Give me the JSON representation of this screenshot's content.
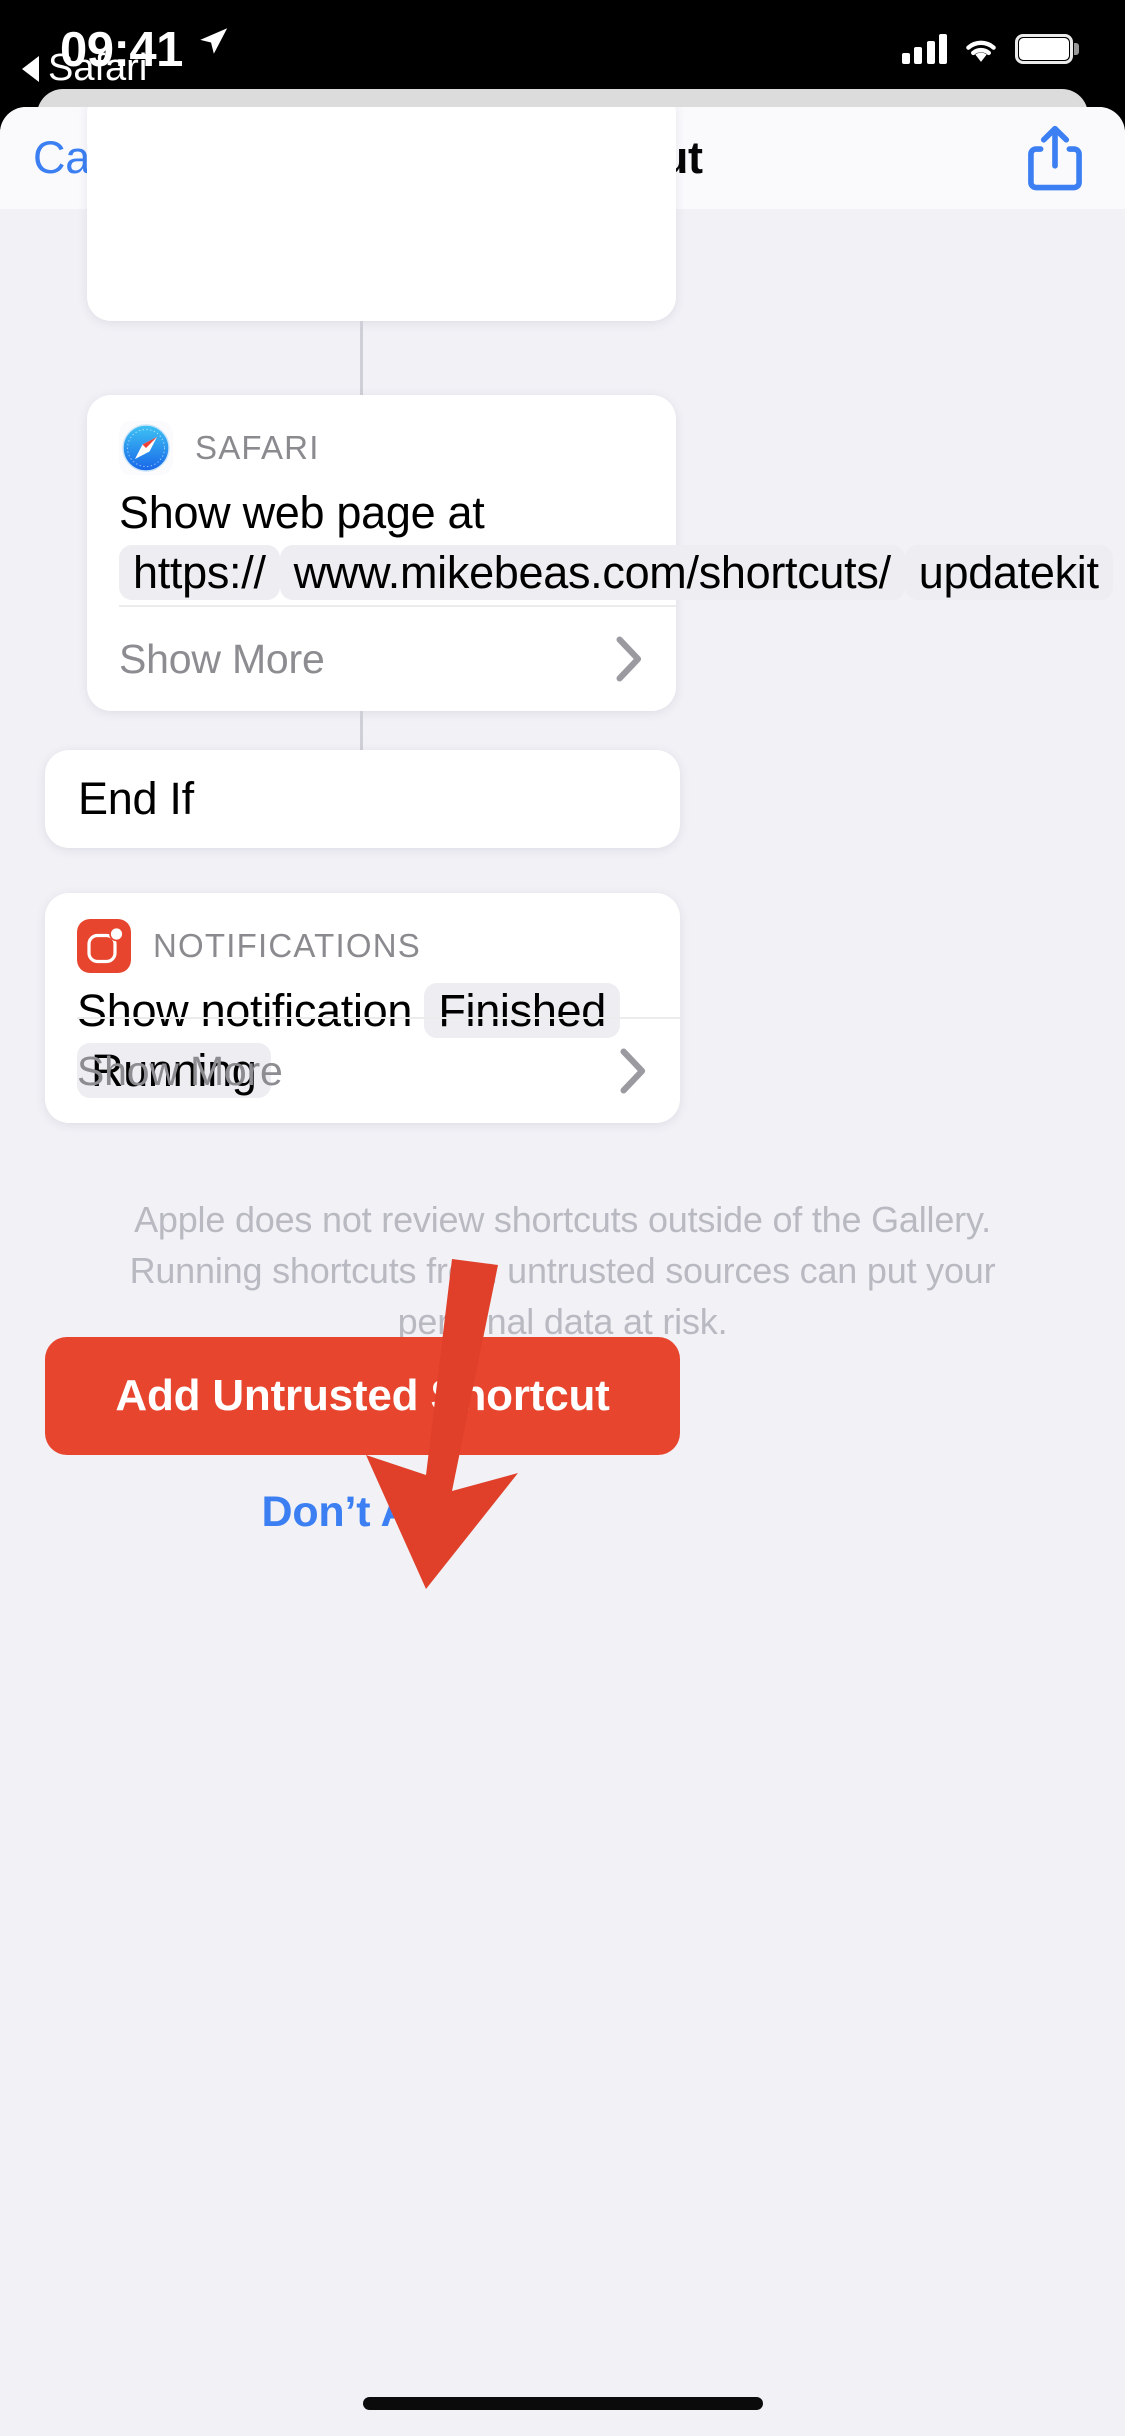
{
  "status_bar": {
    "time": "09:41",
    "location_icon": "location-arrow-icon",
    "cellular_icon": "cellular-signal-icon",
    "wifi_icon": "wifi-icon",
    "battery_icon": "battery-full-icon"
  },
  "back_link": {
    "label": "Safari",
    "icon": "back-triangle-icon"
  },
  "nav_bar": {
    "cancel_label": "Cancel",
    "title": "Add Shortcut",
    "share_icon": "share-icon"
  },
  "actions": [
    {
      "app_name": "SAFARI",
      "app_icon": "safari-compass-icon",
      "text_prefix": "Show web page at",
      "tokens": [
        "https://",
        "www.mikebeas.com/shortcuts/",
        "updatekit"
      ],
      "show_more_label": "Show More",
      "chevron_icon": "chevron-right-icon"
    },
    {
      "app_name": "NOTIFICATIONS",
      "app_icon": "notifications-bell-icon",
      "text_prefix": "Show notification",
      "tokens": [
        "Finished Running"
      ],
      "show_more_label": "Show More",
      "chevron_icon": "chevron-right-icon"
    }
  ],
  "end_if": {
    "label": "End If"
  },
  "disclaimer": {
    "line1": "Apple does not review shortcuts outside of the Gallery.",
    "line2": "Running shortcuts from untrusted sources can put your",
    "line3": "personal data at risk."
  },
  "buttons": {
    "add_untrusted_label": "Add Untrusted Shortcut",
    "dont_add_label": "Don’t Add"
  },
  "annotation": {
    "arrow_icon": "red-pointer-arrow-icon",
    "color": "#e0402a"
  },
  "colors": {
    "accent_blue": "#3b7ff2",
    "destructive_red": "#e8452f",
    "sheet_background": "#f1f1f6",
    "card_background": "#ffffff",
    "token_background": "#ededf2",
    "muted_text": "#8c8c91"
  }
}
